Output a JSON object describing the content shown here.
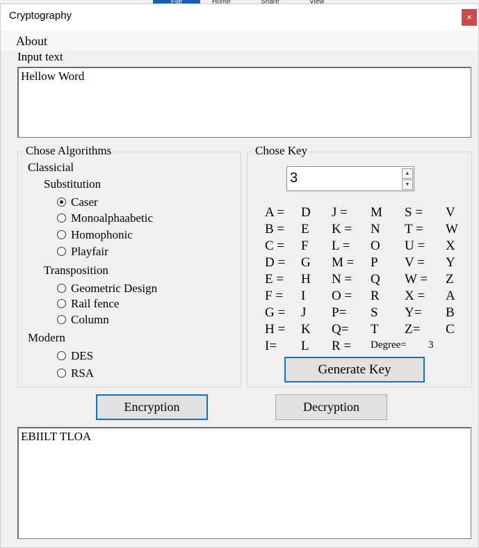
{
  "background_tabs": [
    "File",
    "Home",
    "Share",
    "View"
  ],
  "window": {
    "title": "Cryptography",
    "close_glyph": "×"
  },
  "menu": {
    "about": "About"
  },
  "input": {
    "label": "Input text",
    "value": "Hellow Word"
  },
  "algorithms": {
    "title": "Chose Algorithms",
    "classical_label": "Classicial",
    "substitution_label": "Substitution",
    "substitution_options": [
      "Caser",
      "Monoalphaabetic",
      "Homophonic",
      "Playfair"
    ],
    "transposition_label": "Transposition",
    "transposition_options": [
      "Geometric Design",
      "Rail fence",
      "Column"
    ],
    "modern_label": "Modern",
    "modern_options": [
      "DES",
      "RSA"
    ],
    "selected": "Caser"
  },
  "key": {
    "title": "Chose Key",
    "spinner_value": "3",
    "map_col1": [
      [
        "A =",
        "D"
      ],
      [
        "B =",
        "E"
      ],
      [
        "C =",
        "F"
      ],
      [
        "D =",
        "G"
      ],
      [
        "E =",
        "H"
      ],
      [
        "F =",
        "I"
      ],
      [
        "G =",
        "J"
      ],
      [
        "H =",
        "K"
      ],
      [
        "I=",
        "L"
      ]
    ],
    "map_col2": [
      [
        "J =",
        "M"
      ],
      [
        "K =",
        "N"
      ],
      [
        "L =",
        "O"
      ],
      [
        "M =",
        "P"
      ],
      [
        "N =",
        "Q"
      ],
      [
        "O =",
        "R"
      ],
      [
        "P=",
        "S"
      ],
      [
        "Q=",
        "T"
      ],
      [
        "R =",
        ""
      ]
    ],
    "map_col3": [
      [
        "S =",
        "V"
      ],
      [
        "T =",
        "W"
      ],
      [
        "U =",
        "X"
      ],
      [
        "V =",
        "Y"
      ],
      [
        "W =",
        "Z"
      ],
      [
        "X =",
        "A"
      ],
      [
        "Y=",
        "B"
      ],
      [
        "Z=",
        "C"
      ]
    ],
    "degree_label": "Degree=",
    "degree_value": "3",
    "generate_label": "Generate Key"
  },
  "actions": {
    "encrypt_label": "Encryption",
    "decrypt_label": "Decryption"
  },
  "output": {
    "value": "EBIILT TLOA"
  }
}
